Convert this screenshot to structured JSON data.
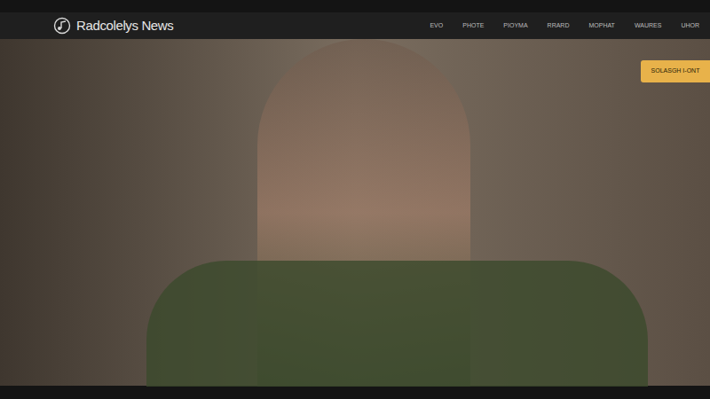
{
  "header": {
    "logo": "Radcolelys News"
  },
  "nav": [
    "EVO",
    "PHOTE",
    "PIOYMA",
    "RRARD",
    "MOPHAT",
    "WAURES",
    "UHOR"
  ],
  "cta": "SOLASGH I-ONT"
}
